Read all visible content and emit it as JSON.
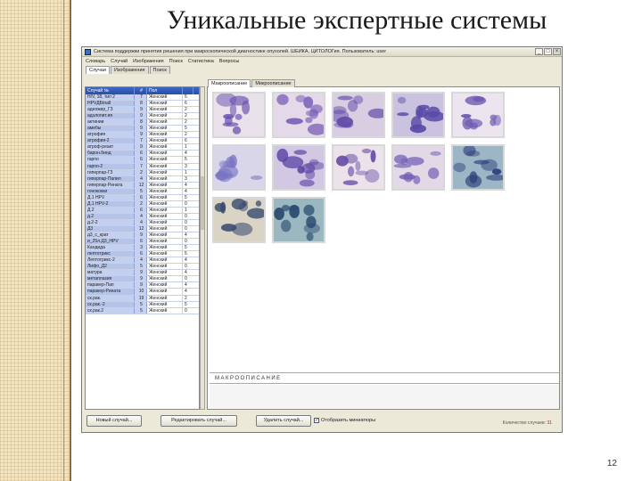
{
  "slide": {
    "title": "Уникальные экспертные системы",
    "page_number": "12"
  },
  "window": {
    "title": "Система поддержки принятия решения при макроскопической диагностике опухолей. ШЕЙКА, ЦИТОЛОГия. Пользователь: user",
    "buttons": {
      "minimize": "_",
      "maximize": "□",
      "close": "×"
    }
  },
  "menu": [
    "Словарь",
    "Случай",
    "Изображения",
    "Поиск",
    "Статистика",
    "Вопросы"
  ],
  "left_tabs": [
    "Случаи",
    "Изображения",
    "Поиск"
  ],
  "grid": {
    "headers": [
      "Случай №",
      "#",
      "Пол",
      ""
    ],
    "rows": [
      [
        "H/V, 18, тип 2",
        "7",
        "Женский",
        "5"
      ],
      [
        "HPVДБtnall",
        "8",
        "Женский",
        "6"
      ],
      [
        "адеожир_ГЗ",
        "9",
        "Женский",
        "2"
      ],
      [
        "адэлопит.ия",
        "9",
        "Женский",
        "2"
      ],
      [
        "актинии",
        "8",
        "Женский",
        "2"
      ],
      [
        "амебы",
        "9",
        "Женский",
        "5"
      ],
      [
        "атрофия",
        "9",
        "Женский",
        "2"
      ],
      [
        "атрофия-2",
        "7",
        "Женский",
        "6"
      ],
      [
        "атроф-реакт",
        "9",
        "Женский",
        "1"
      ],
      [
        "барон.бинд",
        "6",
        "Женский",
        "4"
      ],
      [
        "гарпо",
        "6",
        "Женский",
        "5"
      ],
      [
        "гарпо-2",
        "7",
        "Женский",
        "3"
      ],
      [
        "гиперпар-ГЗ",
        "2",
        "Женский",
        "1"
      ],
      [
        "гиперпар-Папил",
        "4",
        "Женский",
        "3"
      ],
      [
        "гиперпар-Рината",
        "12",
        "Женский",
        "4"
      ],
      [
        "гонококки",
        "5",
        "Женский",
        "4"
      ],
      [
        "Д.1 HPV",
        "6",
        "Женский",
        "5"
      ],
      [
        "Д.1 HPV-2",
        "2",
        "Женский",
        "0"
      ],
      [
        "Д.2",
        "6",
        "Женский",
        "1"
      ],
      [
        "д.2",
        "4",
        "Женский",
        "0"
      ],
      [
        "д.2-2",
        "4",
        "Женский",
        "0"
      ],
      [
        "Д3",
        "12",
        "Женский",
        "0"
      ],
      [
        "д3_с_крат",
        "9",
        "Женский",
        "4"
      ],
      [
        "и_25л.Д3_HPV",
        "6",
        "Женский",
        "0"
      ],
      [
        "Кандида",
        "3",
        "Женский",
        "5"
      ],
      [
        "лептотрикс",
        "6",
        "Женский",
        "5"
      ],
      [
        "Лептотрикс-2",
        "4",
        "Женский",
        "4"
      ],
      [
        "Лифо_Д2",
        "5",
        "Женский",
        "0"
      ],
      [
        "матура",
        "9",
        "Женский",
        "4"
      ],
      [
        "метаплазия",
        "9",
        "Женский",
        "0"
      ],
      [
        "паракер-Пап",
        "9",
        "Женский",
        "4"
      ],
      [
        "паракер-Рината",
        "10",
        "Женский",
        "4"
      ],
      [
        "ск.рак.",
        "19",
        "Женский",
        "2"
      ],
      [
        "ск.рак.-2",
        "5",
        "Женский",
        "5"
      ],
      [
        "ск.рак.2",
        "5",
        "Женский",
        "0"
      ]
    ]
  },
  "right_tabs": [
    "Макроописание",
    "Микроописание"
  ],
  "images": [
    {
      "name": "smear-1",
      "bg": "#e9e2ea",
      "cells": "#6a4fb0"
    },
    {
      "name": "smear-2",
      "bg": "#e4d9e8",
      "cells": "#7b62b8"
    },
    {
      "name": "smear-3",
      "bg": "#d9cde2",
      "cells": "#5d48a6"
    },
    {
      "name": "smear-4",
      "bg": "#cbc2e0",
      "cells": "#5a4aa8"
    },
    {
      "name": "smear-5",
      "bg": "#ece4ee",
      "cells": "#6b58b2"
    },
    {
      "name": "smear-6",
      "bg": "#d8d6e8",
      "cells": "#7a74c4"
    },
    {
      "name": "smear-7",
      "bg": "#d3c8e4",
      "cells": "#5a44a4"
    },
    {
      "name": "smear-8",
      "bg": "#ece3ea",
      "cells": "#6a4fa8"
    },
    {
      "name": "smear-9",
      "bg": "#e2d8e6",
      "cells": "#6e5cb4"
    },
    {
      "name": "smear-10",
      "bg": "#9db6c6",
      "cells": "#2e3e7a"
    },
    {
      "name": "smear-11",
      "bg": "#d9d4c4",
      "cells": "#384a6e"
    },
    {
      "name": "smear-12",
      "bg": "#9bb8c0",
      "cells": "#2a4a70"
    }
  ],
  "macro_label": "МАКРООПИСАНИЕ",
  "buttons": {
    "new_case": "Новый случай...",
    "edit_case": "Редактировать случай...",
    "delete_case": "Удалить случай..."
  },
  "checkbox": {
    "label": "Отобразить миниатюры",
    "checked": true
  },
  "case_count": {
    "label": "Количество случаев:",
    "value": "31"
  }
}
